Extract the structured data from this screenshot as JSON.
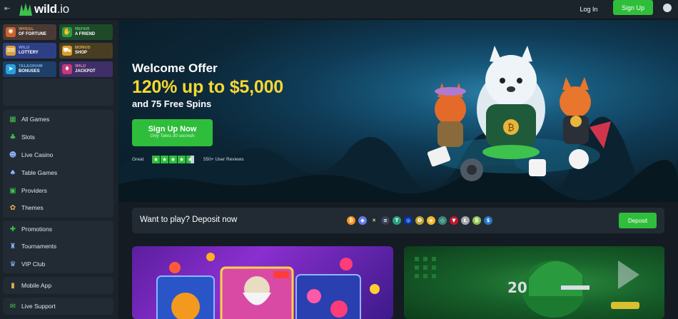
{
  "header": {
    "brand": "wild",
    "brand_suffix": ".io",
    "login_label": "Log In",
    "signup_label": "Sign Up"
  },
  "sidebar": {
    "promos": [
      {
        "line1": "Wheel",
        "line2": "of Fortune",
        "icon": "wheel-icon",
        "color": "#4a3a34"
      },
      {
        "line1": "Refer",
        "line2": "a Friend",
        "icon": "handshake-icon",
        "color": "#1f4a2a"
      },
      {
        "line1": "Wild",
        "line2": "Lottery",
        "icon": "lottery-icon",
        "color": "#2f3f86"
      },
      {
        "line1": "Bonus",
        "line2": "Shop",
        "icon": "shop-icon",
        "color": "#4a3e22"
      },
      {
        "line1": "Telegram",
        "line2": "Bonuses",
        "icon": "telegram-icon",
        "color": "#1e3f67"
      },
      {
        "line1": "Wild",
        "line2": "Jackpot",
        "icon": "jackpot-icon",
        "color": "#3e2f66"
      }
    ],
    "nav_group_1": [
      {
        "label": "All Games",
        "icon": "grid-icon"
      },
      {
        "label": "Slots",
        "icon": "slots-icon"
      },
      {
        "label": "Live Casino",
        "icon": "live-casino-icon"
      },
      {
        "label": "Table Games",
        "icon": "table-games-icon"
      },
      {
        "label": "Providers",
        "icon": "providers-icon"
      },
      {
        "label": "Themes",
        "icon": "themes-icon"
      }
    ],
    "nav_group_2": [
      {
        "label": "Promotions",
        "icon": "gift-icon"
      },
      {
        "label": "Tournaments",
        "icon": "trophy-icon"
      },
      {
        "label": "VIP Club",
        "icon": "vip-icon"
      }
    ],
    "mobile_app": {
      "label": "Mobile App",
      "icon": "mobile-icon"
    },
    "live_support": {
      "label": "Live Support",
      "icon": "support-icon"
    }
  },
  "hero": {
    "title": "Welcome Offer",
    "amount": "120% up to $5,000",
    "spins": "and 75 Free Spins",
    "cta_label": "Sign Up Now",
    "cta_sub": "Only Takes 30 seconds",
    "rating_word": "Great",
    "rating_stars": 4.5,
    "reviews_text": "550+ User Reviews"
  },
  "deposit": {
    "text": "Want to play? Deposit now",
    "button_label": "Deposit",
    "coins": [
      {
        "name": "bitcoin-icon",
        "color": "#f7931a",
        "glyph": "₿"
      },
      {
        "name": "ethereum-icon",
        "color": "#627eea",
        "glyph": "◆"
      },
      {
        "name": "xrp-icon",
        "color": "#23292f",
        "glyph": "✕"
      },
      {
        "name": "solana-icon",
        "color": "#3a3f55",
        "glyph": "≡"
      },
      {
        "name": "tether-icon",
        "color": "#26a17b",
        "glyph": "T"
      },
      {
        "name": "cardano-icon",
        "color": "#0033ad",
        "glyph": "◎"
      },
      {
        "name": "dogecoin-icon",
        "color": "#c2a633",
        "glyph": "Ð"
      },
      {
        "name": "bnb-icon",
        "color": "#f3ba2f",
        "glyph": "◈"
      },
      {
        "name": "toncoin-icon",
        "color": "#3a8a78",
        "glyph": "◇"
      },
      {
        "name": "tron-icon",
        "color": "#c4172e",
        "glyph": "▼"
      },
      {
        "name": "litecoin-icon",
        "color": "#a6a9aa",
        "glyph": "Ł"
      },
      {
        "name": "bitcoin-cash-icon",
        "color": "#8dc351",
        "glyph": "₿"
      },
      {
        "name": "usdc-icon",
        "color": "#2775ca",
        "glyph": "$"
      }
    ]
  }
}
